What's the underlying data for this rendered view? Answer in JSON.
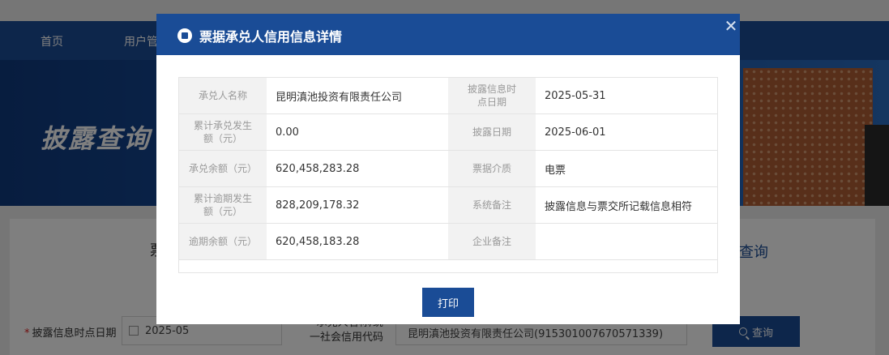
{
  "background": {
    "nav_items": [
      "首页",
      "用户管"
    ],
    "banner_title": "披露查询",
    "panel_tab_left": "票",
    "panel_tab_right": "查询",
    "form": {
      "date_label": "披露信息时点日期",
      "date_value": "2025-05",
      "name_label": "承兑人名称/统一社会信用代码",
      "name_value": "昆明滇池投资有限责任公司(91530100767057133​9)",
      "query_button": "查询"
    }
  },
  "modal": {
    "title": "票据承兑人信用信息详情",
    "close_icon": "close-icon",
    "rows": [
      {
        "label_left": "承兑人名称",
        "value_left": "昆明滇池投资有限责任公司",
        "label_right": "披露信息时点日期",
        "value_right": "2025-05-31"
      },
      {
        "label_left": "累计承兑发生额（元）",
        "value_left": "0.00",
        "label_right": "披露日期",
        "value_right": "2025-06-01"
      },
      {
        "label_left": "承兑余额（元）",
        "value_left": "620,458,283.28",
        "label_right": "票据介质",
        "value_right": "电票"
      },
      {
        "label_left": "累计逾期发生额（元）",
        "value_left": "828,209,178.32",
        "label_right": "系统备注",
        "value_right": "披露信息与票交所记载信息相符"
      },
      {
        "label_left": "逾期余额（元）",
        "value_left": "620,458,183.28",
        "label_right": "企业备注",
        "value_right": ""
      }
    ],
    "print_button": "打印"
  },
  "colors": {
    "brand": "#1a4c96",
    "label_bg": "#f2f2f2",
    "label_text": "#999999",
    "required": "#e02020"
  }
}
